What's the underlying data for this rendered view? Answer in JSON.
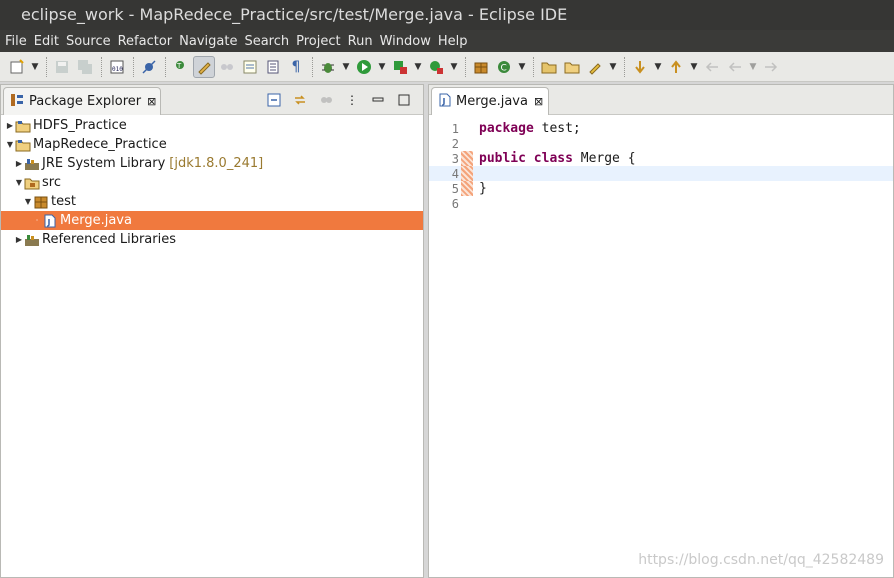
{
  "window": {
    "title": "eclipse_work - MapRedece_Practice/src/test/Merge.java - Eclipse IDE"
  },
  "menu": [
    "File",
    "Edit",
    "Source",
    "Refactor",
    "Navigate",
    "Search",
    "Project",
    "Run",
    "Window",
    "Help"
  ],
  "package_explorer": {
    "tab_label": "Package Explorer",
    "tree": [
      {
        "label": "HDFS_Practice",
        "icon": "project-icon",
        "expanded": false,
        "level": 0
      },
      {
        "label": "MapRedece_Practice",
        "icon": "project-icon",
        "expanded": true,
        "level": 0
      },
      {
        "label": "JRE System Library",
        "decoration": "[jdk1.8.0_241]",
        "icon": "library-icon",
        "expanded": false,
        "level": 1
      },
      {
        "label": "src",
        "icon": "source-folder-icon",
        "expanded": true,
        "level": 1
      },
      {
        "label": "test",
        "icon": "package-icon",
        "expanded": true,
        "level": 2
      },
      {
        "label": "Merge.java",
        "icon": "java-file-icon",
        "selected": true,
        "level": 3
      },
      {
        "label": "Referenced Libraries",
        "icon": "library-icon",
        "expanded": false,
        "level": 1
      }
    ]
  },
  "editor": {
    "tab_label": "Merge.java",
    "lines": [
      {
        "num": "1",
        "text": "package test;",
        "keyword": "package",
        "rest": " test;"
      },
      {
        "num": "2",
        "text": ""
      },
      {
        "num": "3",
        "keyword": "public class",
        "rest": " Merge {"
      },
      {
        "num": "4",
        "text": ""
      },
      {
        "num": "5",
        "text": "}"
      },
      {
        "num": "6",
        "text": ""
      }
    ],
    "current_line": "4"
  },
  "watermark": "https://blog.csdn.net/qq_42582489",
  "colors": {
    "selection": "#f0793e",
    "keyword": "#7f0055",
    "titlebar": "#363634",
    "menubar": "#3a3a38"
  }
}
